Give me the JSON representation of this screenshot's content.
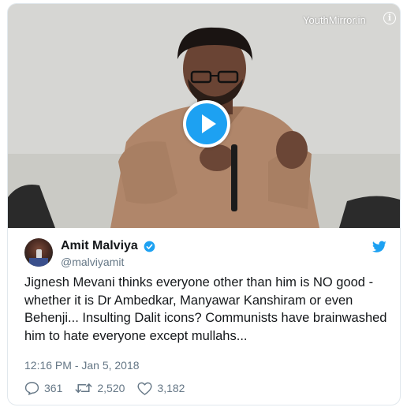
{
  "media": {
    "watermark": "YouthMirror.in",
    "info_icon": "info-icon",
    "play_icon": "play-icon"
  },
  "author": {
    "display_name": "Amit Malviya",
    "handle": "@malviyamit",
    "verified": true
  },
  "tweet": {
    "text": "Jignesh Mevani thinks everyone other than him is NO good - whether it is Dr Ambedkar, Manyawar Kanshiram or even Behenji... Insulting Dalit icons? Communists have brainwashed him to hate everyone except mullahs...",
    "timestamp": "12:16 PM - Jan 5, 2018"
  },
  "actions": {
    "replies": "361",
    "retweets": "2,520",
    "likes": "3,182"
  },
  "colors": {
    "accent": "#1da1f2",
    "text": "#14171a",
    "secondary": "#657786",
    "border": "#e1e8ed"
  }
}
